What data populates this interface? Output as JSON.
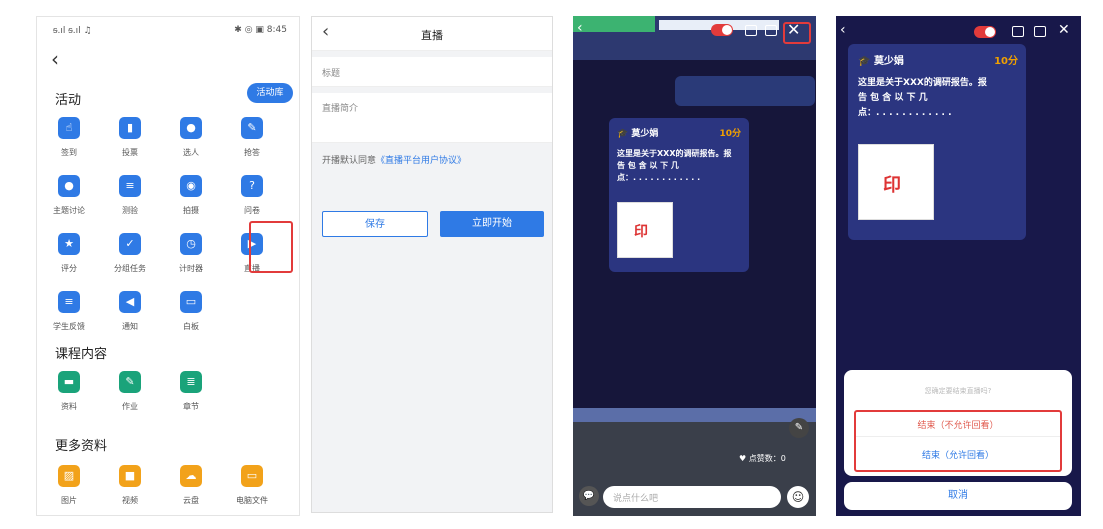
{
  "screen1": {
    "status_left": "ᵴ.ıl ᵴ.ıl ♫",
    "status_right": "✱ ◎ ▣ 8:45",
    "back": "‹",
    "activities_title": "活动",
    "library_button": "活动库",
    "activities": [
      {
        "label": "签到",
        "icon": "tap-icon"
      },
      {
        "label": "投票",
        "icon": "chart-icon"
      },
      {
        "label": "选人",
        "icon": "user-icon"
      },
      {
        "label": "抢答",
        "icon": "microphone-icon"
      },
      {
        "label": "主题讨论",
        "icon": "chat-icon"
      },
      {
        "label": "测验",
        "icon": "quiz-icon"
      },
      {
        "label": "拍摄",
        "icon": "camera-icon"
      },
      {
        "label": "问卷",
        "icon": "question-icon"
      },
      {
        "label": "评分",
        "icon": "rating-icon"
      },
      {
        "label": "分组任务",
        "icon": "group-task-icon"
      },
      {
        "label": "计时器",
        "icon": "timer-icon"
      },
      {
        "label": "直播",
        "icon": "play-icon"
      },
      {
        "label": "学生反馈",
        "icon": "feedback-icon"
      },
      {
        "label": "通知",
        "icon": "speaker-icon"
      },
      {
        "label": "白板",
        "icon": "whiteboard-icon"
      }
    ],
    "content_title": "课程内容",
    "content": [
      {
        "label": "资料",
        "icon": "folder-icon"
      },
      {
        "label": "作业",
        "icon": "homework-icon"
      },
      {
        "label": "章节",
        "icon": "chapter-icon"
      }
    ],
    "more_title": "更多资料",
    "more": [
      {
        "label": "图片",
        "icon": "image-icon"
      },
      {
        "label": "视频",
        "icon": "video-icon"
      },
      {
        "label": "云盘",
        "icon": "cloud-icon"
      },
      {
        "label": "电脑文件",
        "icon": "computer-icon"
      }
    ]
  },
  "screen2": {
    "back": "‹",
    "title": "直播",
    "title_placeholder": "标题",
    "intro_placeholder": "直播简介",
    "agree_prefix": "开播默认同意",
    "agree_link": "《直播平台用户协议》",
    "save": "保存",
    "start": "立即开始"
  },
  "card": {
    "name": "莫少娟",
    "score": "10分",
    "text_line1": "这里是关于XXX的调研报告。报",
    "text_line2": "告 包 含 以 下 几",
    "text_line3": "点：. . . . . . . . . . . ."
  },
  "screen3": {
    "likes": "♥ 点赞数：0",
    "comment_placeholder": "说点什么吧"
  },
  "screen4": {
    "dialog_title": "您确定要结束直播吗?",
    "option1": "结束（不允许回看）",
    "option2": "结束（允许回看）",
    "cancel": "取消"
  },
  "colors": {
    "accent": "#2f7ae5",
    "highlight": "#e23b3b",
    "live_bg": "#16163a",
    "score": "#f0a000"
  }
}
